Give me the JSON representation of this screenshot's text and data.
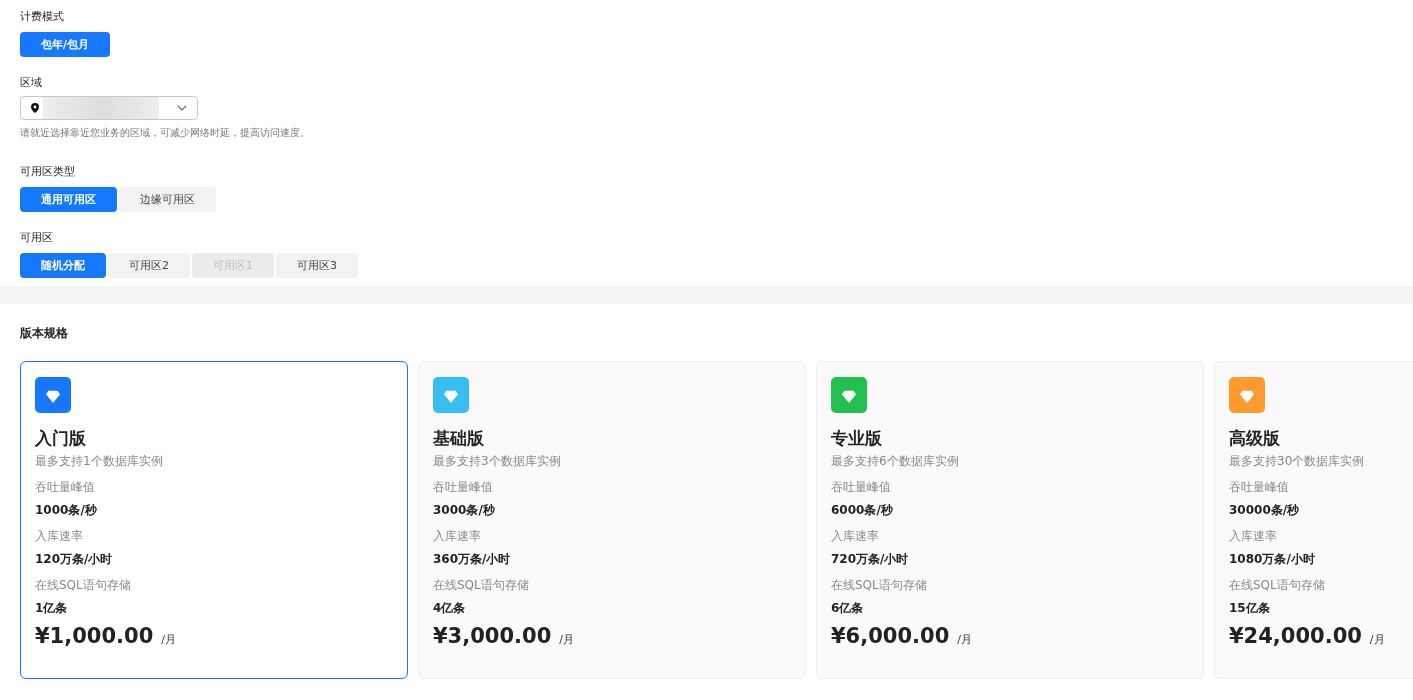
{
  "billing": {
    "label": "计费模式",
    "options": [
      {
        "label": "包年/包月",
        "selected": true,
        "disabled": false
      }
    ]
  },
  "region": {
    "label": "区域",
    "hint": "请就近选择靠近您业务的区域，可减少网络时延，提高访问速度。"
  },
  "zone_type": {
    "label": "可用区类型",
    "options": [
      {
        "label": "通用可用区",
        "selected": true,
        "disabled": false
      },
      {
        "label": "边缘可用区",
        "selected": false,
        "disabled": false
      }
    ]
  },
  "zone": {
    "label": "可用区",
    "options": [
      {
        "label": "随机分配",
        "selected": true,
        "disabled": false
      },
      {
        "label": "可用区2",
        "selected": false,
        "disabled": false
      },
      {
        "label": "可用区1",
        "selected": false,
        "disabled": true
      },
      {
        "label": "可用区3",
        "selected": false,
        "disabled": false
      }
    ]
  },
  "spec": {
    "title": "版本规格",
    "plans": [
      {
        "name": "入门版",
        "color": "#1677ff",
        "selected": true,
        "subtitle": "最多支持1个数据库实例",
        "specs": [
          {
            "label": "吞吐量峰值",
            "value": "1000条/秒"
          },
          {
            "label": "入库速率",
            "value": "120万条/小时"
          },
          {
            "label": "在线SQL语句存储",
            "value": "1亿条"
          }
        ],
        "price": "¥1,000.00",
        "unit": "/月"
      },
      {
        "name": "基础版",
        "color": "#36bff0",
        "selected": false,
        "subtitle": "最多支持3个数据库实例",
        "specs": [
          {
            "label": "吞吐量峰值",
            "value": "3000条/秒"
          },
          {
            "label": "入库速率",
            "value": "360万条/小时"
          },
          {
            "label": "在线SQL语句存储",
            "value": "4亿条"
          }
        ],
        "price": "¥3,000.00",
        "unit": "/月"
      },
      {
        "name": "专业版",
        "color": "#22c04f",
        "selected": false,
        "subtitle": "最多支持6个数据库实例",
        "specs": [
          {
            "label": "吞吐量峰值",
            "value": "6000条/秒"
          },
          {
            "label": "入库速率",
            "value": "720万条/小时"
          },
          {
            "label": "在线SQL语句存储",
            "value": "6亿条"
          }
        ],
        "price": "¥6,000.00",
        "unit": "/月"
      },
      {
        "name": "高级版",
        "color": "#ff9a2e",
        "selected": false,
        "subtitle": "最多支持30个数据库实例",
        "specs": [
          {
            "label": "吞吐量峰值",
            "value": "30000条/秒"
          },
          {
            "label": "入库速率",
            "value": "1080万条/小时"
          },
          {
            "label": "在线SQL语句存储",
            "value": "15亿条"
          }
        ],
        "price": "¥24,000.00",
        "unit": "/月"
      }
    ]
  }
}
